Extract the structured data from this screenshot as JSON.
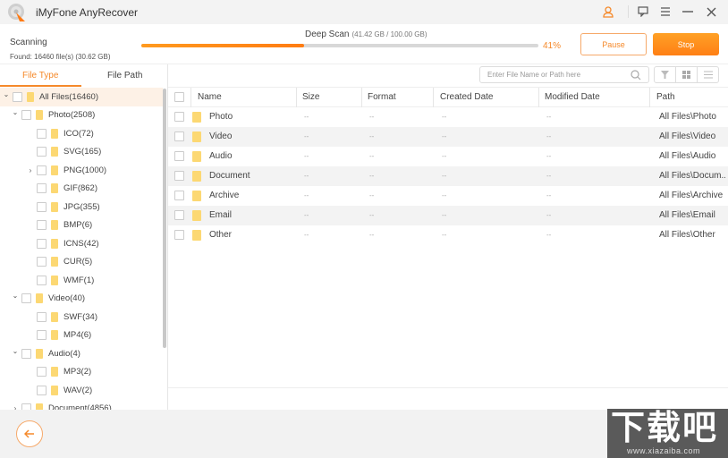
{
  "app": {
    "title": "iMyFone AnyRecover",
    "accent_color": "#f5892a"
  },
  "window_controls": [
    "user-icon",
    "feedback-icon",
    "menu-icon",
    "minimize-icon",
    "close-icon"
  ],
  "scan": {
    "status": "Scanning",
    "found": "Found: 16460 file(s) (30.62 GB)",
    "mode": "Deep Scan",
    "mode_detail": "(41.42 GB / 100.00 GB)",
    "progress_percent": 41,
    "progress_label": "41%",
    "pause_label": "Pause",
    "stop_label": "Stop"
  },
  "left_tabs": {
    "file_type": "File Type",
    "file_path": "File Path"
  },
  "tree": [
    {
      "label": "All Files(16460)",
      "level": 0,
      "arrow": "down",
      "selected": true
    },
    {
      "label": "Photo(2508)",
      "level": 1,
      "arrow": "down"
    },
    {
      "label": "ICO(72)",
      "level": 2,
      "arrow": ""
    },
    {
      "label": "SVG(165)",
      "level": 2,
      "arrow": ""
    },
    {
      "label": "PNG(1000)",
      "level": 2,
      "arrow": "right"
    },
    {
      "label": "GIF(862)",
      "level": 2,
      "arrow": ""
    },
    {
      "label": "JPG(355)",
      "level": 2,
      "arrow": ""
    },
    {
      "label": "BMP(6)",
      "level": 2,
      "arrow": ""
    },
    {
      "label": "ICNS(42)",
      "level": 2,
      "arrow": ""
    },
    {
      "label": "CUR(5)",
      "level": 2,
      "arrow": ""
    },
    {
      "label": "WMF(1)",
      "level": 2,
      "arrow": ""
    },
    {
      "label": "Video(40)",
      "level": 1,
      "arrow": "down"
    },
    {
      "label": "SWF(34)",
      "level": 2,
      "arrow": ""
    },
    {
      "label": "MP4(6)",
      "level": 2,
      "arrow": ""
    },
    {
      "label": "Audio(4)",
      "level": 1,
      "arrow": "down"
    },
    {
      "label": "MP3(2)",
      "level": 2,
      "arrow": ""
    },
    {
      "label": "WAV(2)",
      "level": 2,
      "arrow": ""
    },
    {
      "label": "Document(4856)",
      "level": 1,
      "arrow": "right"
    }
  ],
  "search": {
    "placeholder": "Enter File Name or Path here",
    "value": ""
  },
  "view_buttons": [
    "filter-icon",
    "grid-view-icon",
    "list-view-icon"
  ],
  "table": {
    "columns": [
      "Name",
      "Size",
      "Format",
      "Created Date",
      "Modified Date",
      "Path"
    ],
    "rows": [
      {
        "name": "Photo",
        "size": "--",
        "format": "--",
        "created": "--",
        "modified": "--",
        "path": "All Files\\Photo"
      },
      {
        "name": "Video",
        "size": "--",
        "format": "--",
        "created": "--",
        "modified": "--",
        "path": "All Files\\Video"
      },
      {
        "name": "Audio",
        "size": "--",
        "format": "--",
        "created": "--",
        "modified": "--",
        "path": "All Files\\Audio"
      },
      {
        "name": "Document",
        "size": "--",
        "format": "--",
        "created": "--",
        "modified": "--",
        "path": "All Files\\Docum..."
      },
      {
        "name": "Archive",
        "size": "--",
        "format": "--",
        "created": "--",
        "modified": "--",
        "path": "All Files\\Archive"
      },
      {
        "name": "Email",
        "size": "--",
        "format": "--",
        "created": "--",
        "modified": "--",
        "path": "All Files\\Email"
      },
      {
        "name": "Other",
        "size": "--",
        "format": "--",
        "created": "--",
        "modified": "--",
        "path": "All Files\\Other"
      }
    ]
  },
  "watermark": {
    "big": "下载吧",
    "small": "www.xiazaiba.com"
  }
}
